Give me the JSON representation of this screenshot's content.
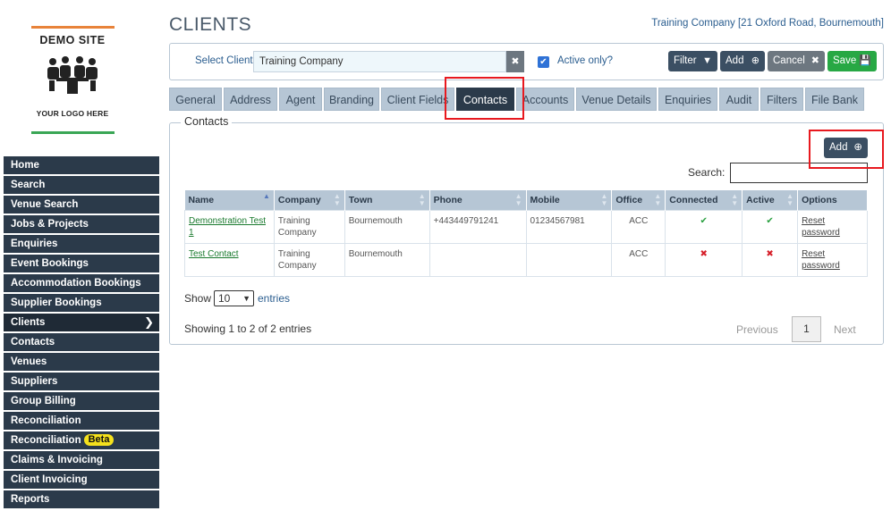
{
  "logo": {
    "site": "DEMO SITE",
    "tagline": "YOUR LOGO HERE"
  },
  "sidebar": {
    "items": [
      {
        "label": "Home"
      },
      {
        "label": "Search"
      },
      {
        "label": "Venue Search"
      },
      {
        "label": "Jobs & Projects"
      },
      {
        "label": "Enquiries"
      },
      {
        "label": "Event Bookings"
      },
      {
        "label": "Accommodation Bookings"
      },
      {
        "label": "Supplier Bookings"
      },
      {
        "label": "Clients",
        "active": true
      },
      {
        "label": "Contacts"
      },
      {
        "label": "Venues"
      },
      {
        "label": "Suppliers"
      },
      {
        "label": "Group Billing"
      },
      {
        "label": "Reconciliation"
      },
      {
        "label": "Reconciliation",
        "badge": "Beta"
      },
      {
        "label": "Claims & Invoicing"
      },
      {
        "label": "Client Invoicing"
      },
      {
        "label": "Reports"
      }
    ]
  },
  "header": {
    "title": "CLIENTS",
    "client_address": "Training Company [21 Oxford Road, Bournemouth]"
  },
  "select_bar": {
    "label": "Select Client",
    "client_value": "Training Company",
    "active_only_label": "Active only?",
    "active_only_checked": true,
    "filter_label": "Filter",
    "add_label": "Add",
    "cancel_label": "Cancel",
    "save_label": "Save"
  },
  "tabs": [
    {
      "label": "General"
    },
    {
      "label": "Address"
    },
    {
      "label": "Agent"
    },
    {
      "label": "Branding"
    },
    {
      "label": "Client Fields"
    },
    {
      "label": "Contacts",
      "active": true
    },
    {
      "label": "Accounts"
    },
    {
      "label": "Venue Details"
    },
    {
      "label": "Enquiries"
    },
    {
      "label": "Audit"
    },
    {
      "label": "Filters"
    },
    {
      "label": "File Bank"
    }
  ],
  "contacts": {
    "legend": "Contacts",
    "add_label": "Add",
    "search_label": "Search:",
    "search_value": "",
    "columns": [
      "Name",
      "Company",
      "Town",
      "Phone",
      "Mobile",
      "Office",
      "Connected",
      "Active",
      "Options"
    ],
    "rows": [
      {
        "name": "Demonstration Test 1",
        "company": "Training Company",
        "town": "Bournemouth",
        "phone": "+443449791241",
        "mobile": "01234567981",
        "office": "ACC",
        "connected": true,
        "active": true,
        "option": "Reset password"
      },
      {
        "name": "Test Contact",
        "company": "Training Company",
        "town": "Bournemouth",
        "phone": "",
        "mobile": "",
        "office": "ACC",
        "connected": false,
        "active": false,
        "option": "Reset password"
      }
    ],
    "show_label": "Show",
    "page_size": "10",
    "entries_label": "entries",
    "info": "Showing 1 to 2 of 2 entries",
    "previous_label": "Previous",
    "current_page": "1",
    "next_label": "Next"
  },
  "colors": {
    "nav_bg": "#2b3a4a",
    "tab_bg": "#b6c6d5",
    "save_green": "#27a844",
    "highlight_red": "#e8191f"
  }
}
